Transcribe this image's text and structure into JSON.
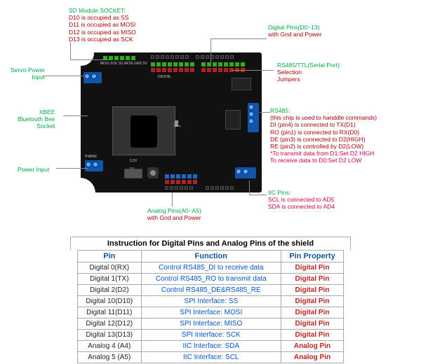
{
  "annotations": {
    "sd": {
      "title": "SD Module SOCKET:",
      "lines": [
        "D10 is occupied as SS",
        "D11 is occupied as MOSI",
        "D12 is occupied as MISO",
        "D13 is occupied as SCK"
      ]
    },
    "digital": {
      "title": "Digital Pins(D0~13)",
      "sub": "with Gnd and Power"
    },
    "servo": {
      "title": "Servo-Power",
      "sub": "Input"
    },
    "rs485sel": {
      "title": "RS485/TTL(Serial Port)",
      "sub": "Selection",
      "sub2": "Jumpers"
    },
    "xbee": {
      "title": "XBEE",
      "sub": "Bluetooth Bee",
      "sub2": "Socket"
    },
    "rs485": {
      "title": "RS485:",
      "note": "(this chip is used to handdle commands)",
      "l0": "DI (pin4) is connected to TX(D1)",
      "l1": "RO (pin1) is connected to RX(D0)",
      "l2": "DE (pin3) is connected to D2(HIGH)",
      "l3": "RE (pin2) is controlled by D2(LOW)",
      "tx": "*To transmit data from D1:Set D2 HIGH",
      "rx": " To receive data to D0:Set D2 LOW"
    },
    "pwin": {
      "title": "Power Input"
    },
    "iic": {
      "title": "IIC Pins:",
      "scl": "SCL is connected to AD5",
      "sda": "SDA is connected to AD4"
    },
    "analog": {
      "title": "Analog Pins(A0~A5)",
      "sub": "with Gnd and Power"
    }
  },
  "table": {
    "title": "Instruction for Digital Pins and Analog Pins of the shield",
    "headers": [
      "Pin",
      "Function",
      "Pin Property"
    ],
    "rows": [
      {
        "pin": "Digital 0(RX)",
        "fn": "Control RS485_DI to receive data",
        "prop": "Digital Pin"
      },
      {
        "pin": "Digital 1(TX)",
        "fn": "Control RS485_RO to transmit data",
        "prop": "Digital Pin"
      },
      {
        "pin": "Digital 2(D2)",
        "fn": "Control RS485_DE&RS485_RE",
        "prop": "Digital Pin"
      },
      {
        "pin": "Digital 10(D10)",
        "fn": "SPI Interface: SS",
        "prop": "Digital Pin"
      },
      {
        "pin": "Digital 11(D11)",
        "fn": "SPI Interface: MOSI",
        "prop": "Digital Pin"
      },
      {
        "pin": "Digital 12(D12)",
        "fn": "SPI Interface: MISO",
        "prop": "Digital Pin"
      },
      {
        "pin": "Digital 13(D13)",
        "fn": "SPI Interface: SCK",
        "prop": "Digital Pin"
      },
      {
        "pin": "Analog 4 (A4)",
        "fn": "IIC Interface: SDA",
        "prop": "Analog Pin"
      },
      {
        "pin": "Analog 5 (A5)",
        "fn": "IIC Interface: SCL",
        "prop": "Analog Pin"
      }
    ]
  },
  "board_labels": {
    "top_analog": "MISO SCK SS MOSI GND 5V",
    "pwrin": "PWRIN",
    "33": "3.3V",
    "5v": "5V",
    "ss": "ss",
    "digital": "DIGITAL"
  }
}
